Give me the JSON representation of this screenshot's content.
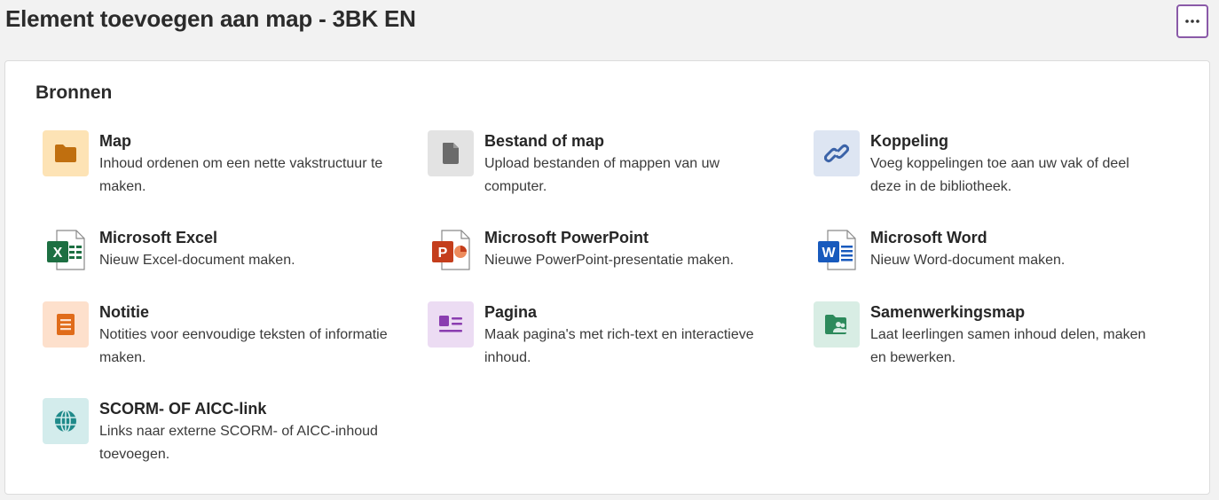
{
  "header": {
    "title": "Element toevoegen aan map - 3BK EN",
    "more_icon": "more-horizontal-icon"
  },
  "sources": {
    "title": "Bronnen",
    "items": [
      {
        "title": "Map",
        "desc": "Inhoud ordenen om een nette vakstructuur te maken.",
        "icon": "folder-icon",
        "icon_bg": "#fde3b5",
        "icon_color": "#c06f0f"
      },
      {
        "title": "Bestand of map",
        "desc": "Upload bestanden of mappen van uw computer.",
        "icon": "file-icon",
        "icon_bg": "#e3e3e3",
        "icon_color": "#6b6b6b"
      },
      {
        "title": "Koppeling",
        "desc": "Voeg koppelingen toe aan uw vak of deel deze in de bibliotheek.",
        "icon": "link-icon",
        "icon_bg": "#dde5f2",
        "icon_color": "#3b63a8"
      },
      {
        "title": "Microsoft Excel",
        "desc": "Nieuw Excel-document maken.",
        "icon": "excel-icon",
        "icon_bg": "transparent",
        "icon_color": "#1d6f42"
      },
      {
        "title": "Microsoft PowerPoint",
        "desc": "Nieuwe PowerPoint-presentatie maken.",
        "icon": "powerpoint-icon",
        "icon_bg": "transparent",
        "icon_color": "#c43e1c"
      },
      {
        "title": "Microsoft Word",
        "desc": "Nieuw Word-document maken.",
        "icon": "word-icon",
        "icon_bg": "transparent",
        "icon_color": "#185abd"
      },
      {
        "title": "Notitie",
        "desc": "Notities voor eenvoudige teksten of informatie maken.",
        "icon": "note-icon",
        "icon_bg": "#fde0cc",
        "icon_color": "#e06c1a"
      },
      {
        "title": "Pagina",
        "desc": "Maak pagina's met rich-text en interactieve inhoud.",
        "icon": "page-icon",
        "icon_bg": "#ecdcf3",
        "icon_color": "#8a3db0"
      },
      {
        "title": "Samenwerkingsmap",
        "desc": "Laat leerlingen samen inhoud delen, maken en bewerken.",
        "icon": "collaboration-folder-icon",
        "icon_bg": "#d8ede4",
        "icon_color": "#2d8a5c"
      },
      {
        "title": "SCORM- OF AICC-link",
        "desc": "Links naar externe SCORM- of AICC-inhoud toevoegen.",
        "icon": "globe-icon",
        "icon_bg": "#d3ecec",
        "icon_color": "#1f8a8a"
      }
    ]
  }
}
